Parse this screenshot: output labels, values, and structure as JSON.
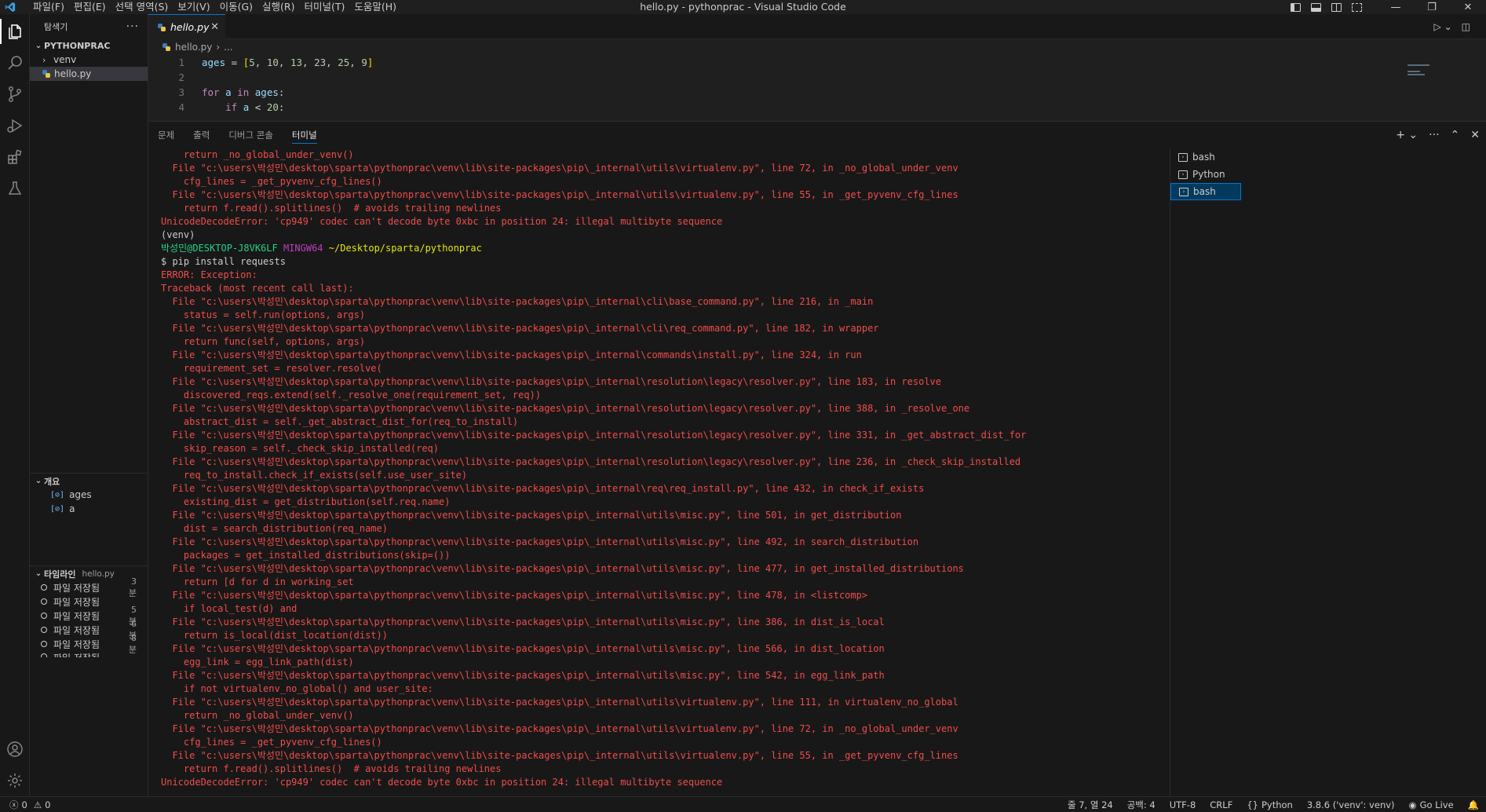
{
  "titlebar": {
    "title": "hello.py - pythonprac - Visual Studio Code",
    "menus": [
      "파일(F)",
      "편집(E)",
      "선택 영역(S)",
      "보기(V)",
      "이동(G)",
      "실행(R)",
      "터미널(T)",
      "도움말(H)"
    ]
  },
  "sidebar": {
    "header": "탐색기",
    "project": "PYTHONPRAC",
    "files": [
      "venv",
      "hello.py"
    ],
    "outline_title": "개요",
    "outline_items": [
      "ages",
      "a"
    ],
    "timeline_title": "타임라인",
    "timeline_file": "hello.py",
    "timeline_items": [
      {
        "label": "파일 저장됨",
        "time": "3분"
      },
      {
        "label": "파일 저장됨",
        "time": ""
      },
      {
        "label": "파일 저장됨",
        "time": "5분"
      },
      {
        "label": "파일 저장됨",
        "time": "6분"
      },
      {
        "label": "파일 저장됨",
        "time": "8분"
      },
      {
        "label": "파일 저장됨",
        "time": ""
      }
    ]
  },
  "editor": {
    "tab_label": "hello.py",
    "breadcrumb_file": "hello.py",
    "breadcrumb_more": "...",
    "line_numbers": [
      "1",
      "2",
      "3",
      "4"
    ]
  },
  "panel": {
    "tabs": [
      "문제",
      "출력",
      "디버그 콘솔",
      "터미널"
    ],
    "terminals": [
      "bash",
      "Python",
      "bash"
    ],
    "lines_before": [
      "    return _no_global_under_venv()",
      "  File \"c:\\users\\박성민\\desktop\\sparta\\pythonprac\\venv\\lib\\site-packages\\pip\\_internal\\utils\\virtualenv.py\", line 72, in _no_global_under_venv",
      "    cfg_lines = _get_pyvenv_cfg_lines()",
      "  File \"c:\\users\\박성민\\desktop\\sparta\\pythonprac\\venv\\lib\\site-packages\\pip\\_internal\\utils\\virtualenv.py\", line 55, in _get_pyvenv_cfg_lines",
      "    return f.read().splitlines()  # avoids trailing newlines",
      "UnicodeDecodeError: 'cp949' codec can't decode byte 0xbc in position 24: illegal multibyte sequence"
    ],
    "venv_line": "(venv)",
    "prompt_user": "박성민@DESKTOP-J8VK6LF",
    "prompt_host": "MINGW64",
    "prompt_path": "~/Desktop/sparta/pythonprac",
    "command": "$ pip install requests",
    "lines_after": [
      "ERROR: Exception:",
      "Traceback (most recent call last):",
      "  File \"c:\\users\\박성민\\desktop\\sparta\\pythonprac\\venv\\lib\\site-packages\\pip\\_internal\\cli\\base_command.py\", line 216, in _main",
      "    status = self.run(options, args)",
      "  File \"c:\\users\\박성민\\desktop\\sparta\\pythonprac\\venv\\lib\\site-packages\\pip\\_internal\\cli\\req_command.py\", line 182, in wrapper",
      "    return func(self, options, args)",
      "  File \"c:\\users\\박성민\\desktop\\sparta\\pythonprac\\venv\\lib\\site-packages\\pip\\_internal\\commands\\install.py\", line 324, in run",
      "    requirement_set = resolver.resolve(",
      "  File \"c:\\users\\박성민\\desktop\\sparta\\pythonprac\\venv\\lib\\site-packages\\pip\\_internal\\resolution\\legacy\\resolver.py\", line 183, in resolve",
      "    discovered_reqs.extend(self._resolve_one(requirement_set, req))",
      "  File \"c:\\users\\박성민\\desktop\\sparta\\pythonprac\\venv\\lib\\site-packages\\pip\\_internal\\resolution\\legacy\\resolver.py\", line 388, in _resolve_one",
      "    abstract_dist = self._get_abstract_dist_for(req_to_install)",
      "  File \"c:\\users\\박성민\\desktop\\sparta\\pythonprac\\venv\\lib\\site-packages\\pip\\_internal\\resolution\\legacy\\resolver.py\", line 331, in _get_abstract_dist_for",
      "    skip_reason = self._check_skip_installed(req)",
      "  File \"c:\\users\\박성민\\desktop\\sparta\\pythonprac\\venv\\lib\\site-packages\\pip\\_internal\\resolution\\legacy\\resolver.py\", line 236, in _check_skip_installed",
      "    req_to_install.check_if_exists(self.use_user_site)",
      "  File \"c:\\users\\박성민\\desktop\\sparta\\pythonprac\\venv\\lib\\site-packages\\pip\\_internal\\req\\req_install.py\", line 432, in check_if_exists",
      "    existing_dist = get_distribution(self.req.name)",
      "  File \"c:\\users\\박성민\\desktop\\sparta\\pythonprac\\venv\\lib\\site-packages\\pip\\_internal\\utils\\misc.py\", line 501, in get_distribution",
      "    dist = search_distribution(req_name)",
      "  File \"c:\\users\\박성민\\desktop\\sparta\\pythonprac\\venv\\lib\\site-packages\\pip\\_internal\\utils\\misc.py\", line 492, in search_distribution",
      "    packages = get_installed_distributions(skip=())",
      "  File \"c:\\users\\박성민\\desktop\\sparta\\pythonprac\\venv\\lib\\site-packages\\pip\\_internal\\utils\\misc.py\", line 477, in get_installed_distributions",
      "    return [d for d in working_set",
      "  File \"c:\\users\\박성민\\desktop\\sparta\\pythonprac\\venv\\lib\\site-packages\\pip\\_internal\\utils\\misc.py\", line 478, in <listcomp>",
      "    if local_test(d) and",
      "  File \"c:\\users\\박성민\\desktop\\sparta\\pythonprac\\venv\\lib\\site-packages\\pip\\_internal\\utils\\misc.py\", line 386, in dist_is_local",
      "    return is_local(dist_location(dist))",
      "  File \"c:\\users\\박성민\\desktop\\sparta\\pythonprac\\venv\\lib\\site-packages\\pip\\_internal\\utils\\misc.py\", line 566, in dist_location",
      "    egg_link = egg_link_path(dist)",
      "  File \"c:\\users\\박성민\\desktop\\sparta\\pythonprac\\venv\\lib\\site-packages\\pip\\_internal\\utils\\misc.py\", line 542, in egg_link_path",
      "    if not virtualenv_no_global() and user_site:",
      "  File \"c:\\users\\박성민\\desktop\\sparta\\pythonprac\\venv\\lib\\site-packages\\pip\\_internal\\utils\\virtualenv.py\", line 111, in virtualenv_no_global",
      "    return _no_global_under_venv()",
      "  File \"c:\\users\\박성민\\desktop\\sparta\\pythonprac\\venv\\lib\\site-packages\\pip\\_internal\\utils\\virtualenv.py\", line 72, in _no_global_under_venv",
      "    cfg_lines = _get_pyvenv_cfg_lines()",
      "  File \"c:\\users\\박성민\\desktop\\sparta\\pythonprac\\venv\\lib\\site-packages\\pip\\_internal\\utils\\virtualenv.py\", line 55, in _get_pyvenv_cfg_lines",
      "    return f.read().splitlines()  # avoids trailing newlines",
      "UnicodeDecodeError: 'cp949' codec can't decode byte 0xbc in position 24: illegal multibyte sequence"
    ]
  },
  "statusbar": {
    "errors": "0",
    "warnings": "0",
    "position": "줄 7, 열 24",
    "spaces": "공백: 4",
    "encoding": "UTF-8",
    "eol": "CRLF",
    "language": "Python",
    "interpreter": "3.8.6 ('venv': venv)",
    "golive": "Go Live"
  }
}
